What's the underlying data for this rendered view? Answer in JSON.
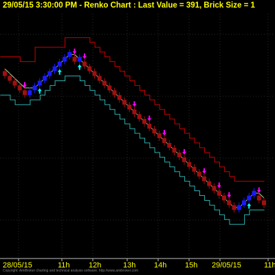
{
  "header": {
    "title": "29/05/15 3:30:00 PM - Renko Chart : Last Value = 391, Brick Size = 1"
  },
  "footer": {
    "copyright": "Copyright: AmiBroker charting and technical analysis software. http://www.amibroker.com"
  },
  "colors": {
    "background": "#000000",
    "grid": "#2a2a2a",
    "up_brick": "#1a1aff",
    "down_brick": "#a01010",
    "upper_band": "#cc0000",
    "lower_band": "#2ab0b0",
    "center_line": "#a0d8a0",
    "buy_arrow": "#00ffff",
    "sell_arrow": "#ff00ff",
    "axis_text": "#ffff00"
  },
  "chart_data": {
    "type": "renko",
    "title": "29/05/15 3:30:00 PM - Renko Chart : Last Value = 391, Brick Size = 1",
    "brick_size": 1,
    "last_value": 391,
    "x_tick_labels": [
      "28/05/15",
      "11h",
      "12h",
      "13h",
      "14h",
      "15h",
      "29/05/15",
      "11h"
    ],
    "y_range": [
      387,
      438
    ],
    "series": [
      {
        "name": "bricks",
        "directions": [
          "down",
          "down",
          "down",
          "down",
          "down",
          "up",
          "up",
          "up",
          "up",
          "up",
          "up",
          "up",
          "up",
          "up",
          "down",
          "up",
          "down",
          "down",
          "down",
          "down",
          "down",
          "down",
          "down",
          "down",
          "down",
          "down",
          "down",
          "down",
          "down",
          "down",
          "down",
          "down",
          "down",
          "down",
          "down",
          "down",
          "down",
          "down",
          "down",
          "down",
          "down",
          "down",
          "down",
          "down",
          "down",
          "down",
          "down",
          "up",
          "up",
          "up",
          "up",
          "down",
          "down"
        ],
        "lows": [
          425,
          424,
          423,
          422,
          421,
          421,
          422,
          423,
          424,
          425,
          426,
          427,
          428,
          429,
          428,
          428,
          427,
          426,
          425,
          424,
          423,
          422,
          421,
          420,
          419,
          418,
          417,
          416,
          415,
          414,
          413,
          412,
          411,
          410,
          409,
          408,
          407,
          406,
          405,
          404,
          403,
          402,
          401,
          400,
          399,
          398,
          397,
          397,
          398,
          399,
          400,
          399,
          398
        ]
      },
      {
        "name": "upper band",
        "values": [
          429,
          429,
          429,
          429,
          428,
          428,
          428,
          431,
          431,
          431,
          431,
          431,
          431,
          433,
          433,
          433,
          433,
          433,
          432,
          431,
          430,
          429,
          428,
          427,
          426,
          425,
          424,
          423,
          422,
          421,
          420,
          419,
          418,
          417,
          416,
          415,
          414,
          413,
          412,
          411,
          410,
          409,
          408,
          407,
          406,
          405,
          404,
          403,
          403,
          403,
          403,
          403,
          403
        ]
      },
      {
        "name": "lower band",
        "values": [
          421,
          421,
          420,
          419,
          419,
          419,
          420,
          420,
          421,
          422,
          423,
          424,
          424,
          425,
          425,
          425,
          424,
          423,
          422,
          421,
          420,
          419,
          418,
          417,
          416,
          415,
          414,
          413,
          412,
          411,
          410,
          409,
          408,
          407,
          406,
          405,
          404,
          403,
          402,
          401,
          400,
          399,
          398,
          397,
          396,
          395,
          394,
          394,
          394,
          396,
          397,
          397,
          397
        ]
      },
      {
        "name": "center",
        "values": [
          426,
          425,
          424,
          423,
          422,
          422,
          422,
          423,
          424,
          425,
          426,
          427,
          428,
          429,
          429,
          428,
          427,
          426,
          425,
          424,
          423,
          422,
          421,
          420,
          419,
          418,
          417,
          416,
          415,
          414,
          413,
          412,
          411,
          410,
          409,
          408,
          407,
          406,
          405,
          404,
          403,
          402,
          401,
          400,
          399,
          398,
          397,
          397,
          398,
          399,
          400,
          400,
          399
        ]
      },
      {
        "name": "buy signals",
        "indices": [
          7,
          11,
          15,
          49
        ]
      },
      {
        "name": "sell signals",
        "indices": [
          4,
          14,
          16,
          26,
          29,
          32,
          36,
          40,
          43,
          45,
          51
        ]
      }
    ]
  }
}
